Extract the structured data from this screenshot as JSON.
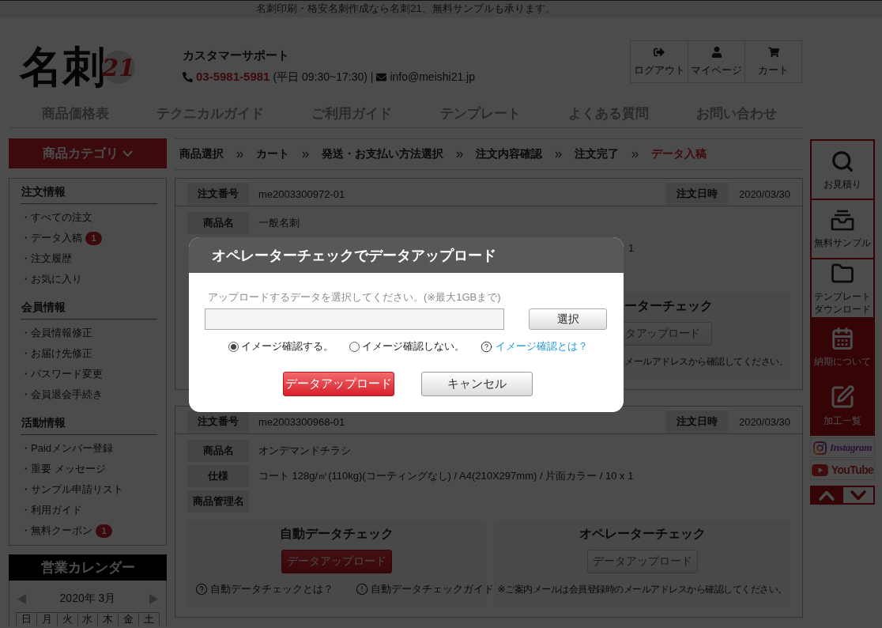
{
  "top_bar": {
    "text": "名刺印刷・格安名刺作成なら名刺21。無料サンプルも承ります。"
  },
  "header": {
    "logo": {
      "text": "名刺",
      "number": "21"
    },
    "support": {
      "title": "カスタマーサポート",
      "phone": "03-5981-5981",
      "hours": "(平日 09:30~17:30) |",
      "email": "info@meishi21.jp"
    },
    "account_buttons": [
      {
        "kind": "logout",
        "label": "ログアウト"
      },
      {
        "kind": "user",
        "label": "マイページ"
      },
      {
        "kind": "cart",
        "label": "カート"
      }
    ]
  },
  "nav": [
    "商品価格表",
    "テクニカルガイド",
    "ご利用ガイド",
    "テンプレート",
    "よくある質問",
    "お問い合わせ"
  ],
  "sidebar": {
    "category_button": "商品カテゴリ",
    "sections": [
      {
        "title": "注文情報",
        "items": [
          {
            "label": "・すべての注文"
          },
          {
            "label": "・データ入稿",
            "badge": "1"
          },
          {
            "label": "・注文履歴"
          },
          {
            "label": "・お気に入り"
          }
        ]
      },
      {
        "title": "会員情報",
        "items": [
          {
            "label": "・会員情報修正"
          },
          {
            "label": "・お届け先修正"
          },
          {
            "label": "・パスワード変更"
          },
          {
            "label": "・会員退会手続き"
          }
        ]
      },
      {
        "title": "活動情報",
        "items": [
          {
            "label": "・Paidメンバー登録"
          },
          {
            "label": "・重要 メッセージ"
          },
          {
            "label": "・サンプル申請リスト"
          },
          {
            "label": "・利用ガイド"
          },
          {
            "label": "・無料クーポン",
            "badge": "1"
          }
        ]
      }
    ],
    "calendar": {
      "title": "営業カレンダー",
      "month": "2020年 3月",
      "weekdays": [
        "日",
        "月",
        "火",
        "水",
        "木",
        "金",
        "土"
      ]
    }
  },
  "breadcrumb": [
    {
      "label": "商品選択",
      "selected": false
    },
    {
      "label": "カート",
      "selected": false
    },
    {
      "label": "発送・お支払い方法選択",
      "selected": false
    },
    {
      "label": "注文内容確認",
      "selected": false
    },
    {
      "label": "注文完了",
      "selected": false
    },
    {
      "label": "データ入稿",
      "selected": true
    }
  ],
  "orders": [
    {
      "kind": "covered",
      "number_label": "注文番号",
      "number": "me2003300972-01",
      "date_label": "注文日時",
      "date": "2020/03/30",
      "rows": [
        {
          "label": "商品名",
          "value": "一般名刺"
        }
      ],
      "visible_fragments": {
        "spec_end": "1",
        "check_title": "ーターチェック",
        "check_button": "タアップロード",
        "check_note": "メールアドレスから確認してください。"
      }
    },
    {
      "kind": "full",
      "number_label": "注文番号",
      "number": "me2003300968-01",
      "date_label": "注文日時",
      "date": "2020/03/30",
      "rows": [
        {
          "label": "商品名",
          "value": "オンデマンドチラシ"
        },
        {
          "label": "仕様",
          "value": "コート 128g/㎡(110kg)(コーティングなし) / A4(210X297mm) / 片面カラー / 10 x 1"
        },
        {
          "label": "商品管理名"
        }
      ],
      "auto_check": {
        "title": "自動データチェック",
        "button": "データアップロード",
        "links": [
          {
            "kind": "question",
            "label": "自動データチェックとは？"
          },
          {
            "kind": "notice",
            "label": "自動データチェックガイド"
          }
        ]
      },
      "operator_check": {
        "title": "オペレーターチェック",
        "button": "データアップロード",
        "note": "※ご案内メールは会員登録時のメールアドレスから確認してください。"
      }
    }
  ],
  "modal": {
    "title": "オペレーターチェックでデータアップロード",
    "hint": "アップロードするデータを選択してください。(※最大1GBまで)",
    "select_button": "選択",
    "image_check_options": [
      {
        "label": "イメージ確認する。",
        "selected": true
      },
      {
        "label": "イメージ確認しない。",
        "selected": false
      }
    ],
    "help_link": "イメージ確認とは？",
    "buttons": [
      {
        "kind": "primary",
        "label": "データアップロード"
      },
      {
        "kind": "secondary",
        "label": "キャンセル"
      }
    ]
  },
  "right_rail": {
    "items": [
      {
        "kind": "search",
        "filled": false,
        "label": "お見積り"
      },
      {
        "kind": "tray",
        "filled": false,
        "label": "無料サンプル"
      },
      {
        "kind": "folder",
        "filled": false,
        "label": "テンプレートダウンロード"
      },
      {
        "kind": "calendar",
        "filled": true,
        "label": "納期について"
      },
      {
        "kind": "pencil",
        "filled": true,
        "label": "加工一覧"
      }
    ],
    "social": [
      {
        "kind": "instagram",
        "label": "Instagram"
      },
      {
        "kind": "youtube",
        "label": "YouTube"
      }
    ]
  }
}
